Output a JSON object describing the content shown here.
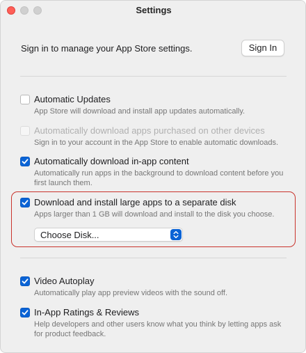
{
  "window": {
    "title": "Settings"
  },
  "signin": {
    "text": "Sign in to manage your App Store settings.",
    "button_label": "Sign In"
  },
  "options": [
    {
      "label": "Automatic Updates",
      "description": "App Store will download and install app updates automatically.",
      "checked": false,
      "disabled": false
    },
    {
      "label": "Automatically download apps purchased on other devices",
      "description": "Sign in to your account in the App Store to enable automatic downloads.",
      "checked": false,
      "disabled": true
    },
    {
      "label": "Automatically download in-app content",
      "description": "Automatically run apps in the background to download content before you first launch them.",
      "checked": true,
      "disabled": false
    },
    {
      "label": "Download and install large apps to a separate disk",
      "description": "Apps larger than 1 GB will download and install to the disk you choose.",
      "checked": true,
      "disabled": false
    },
    {
      "label": "Video Autoplay",
      "description": "Automatically play app preview videos with the sound off.",
      "checked": true,
      "disabled": false
    },
    {
      "label": "In-App Ratings & Reviews",
      "description": "Help developers and other users know what you think by letting apps ask for product feedback.",
      "checked": true,
      "disabled": false
    }
  ],
  "disk_picker": {
    "selected": "Choose Disk..."
  },
  "colors": {
    "accent": "#0a63d5",
    "highlight_border": "#c9332c",
    "close_button": "#ff5f57"
  }
}
